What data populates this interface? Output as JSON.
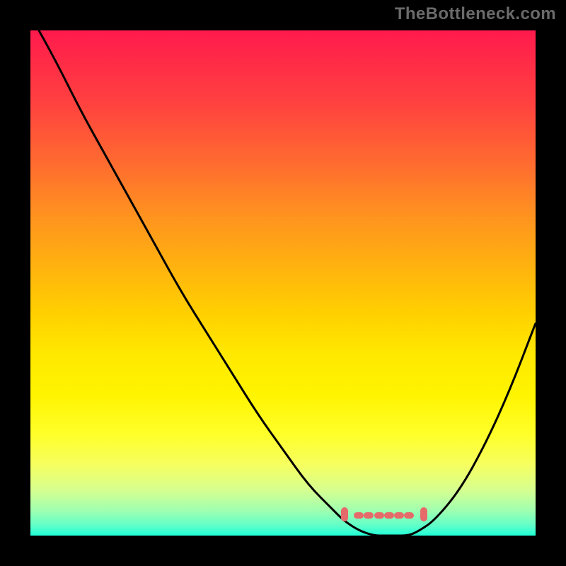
{
  "watermark": "TheBottleneck.com",
  "colors": {
    "curve": "#000000",
    "tick": "#e66a6a",
    "frame": "#000000"
  },
  "chart_data": {
    "type": "line",
    "title": "",
    "xlabel": "",
    "ylabel": "",
    "xlim": [
      0,
      100
    ],
    "ylim": [
      0,
      100
    ],
    "x": [
      0,
      5,
      10,
      15,
      20,
      25,
      30,
      35,
      40,
      45,
      50,
      55,
      60,
      62,
      65,
      68,
      70,
      72,
      75,
      77,
      80,
      85,
      90,
      95,
      100
    ],
    "values": [
      103,
      94,
      84,
      75,
      66,
      57,
      48,
      40,
      32,
      24,
      17,
      10,
      5,
      3,
      1,
      0,
      0,
      0,
      0,
      1,
      3,
      9,
      18,
      29,
      42
    ],
    "optimal_range_x": [
      62,
      78
    ],
    "ticks_x": [
      62,
      65,
      67,
      69,
      71,
      73,
      75,
      78
    ]
  }
}
